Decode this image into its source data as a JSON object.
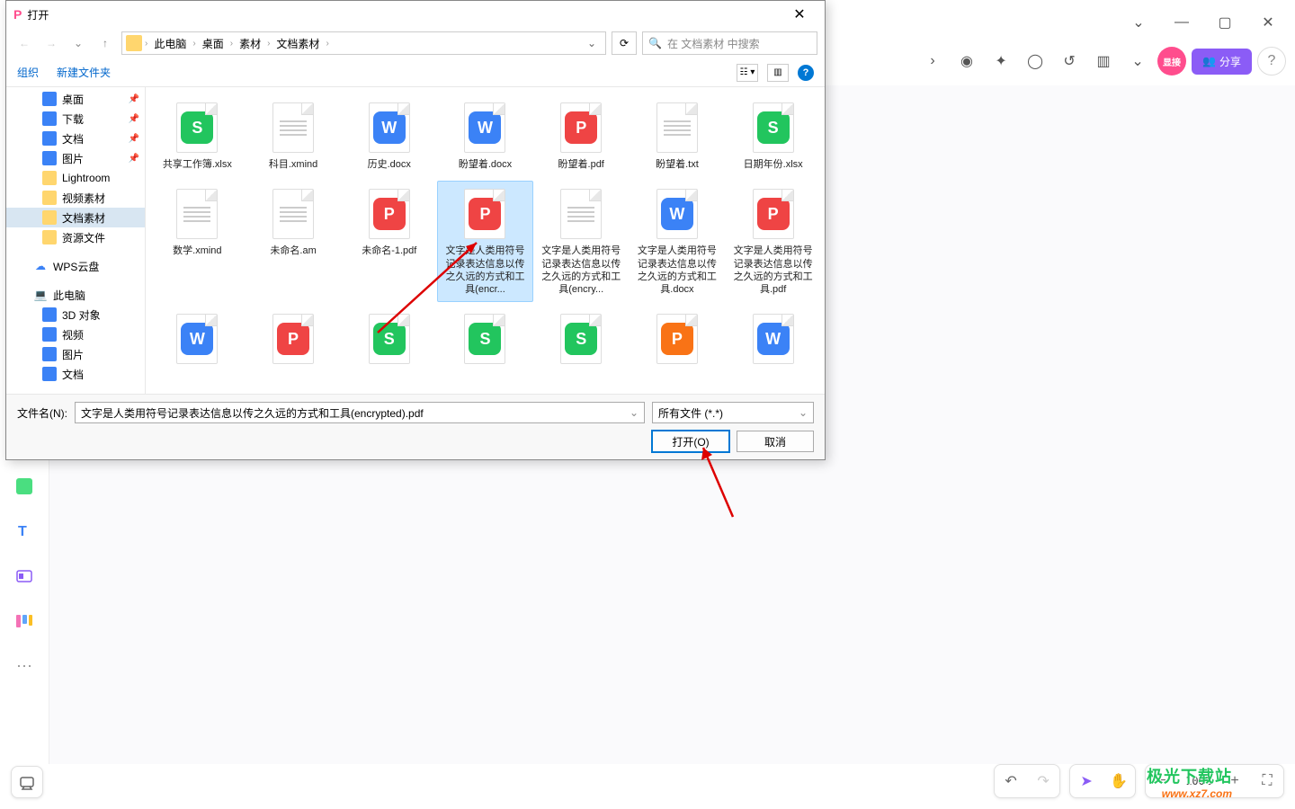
{
  "dialog": {
    "title": "打开",
    "breadcrumb": [
      "此电脑",
      "桌面",
      "素材",
      "文档素材"
    ],
    "search_placeholder": "在 文档素材 中搜索",
    "organize": "组织",
    "new_folder": "新建文件夹",
    "filename_label": "文件名(N):",
    "filename_value": "文字是人类用符号记录表达信息以传之久远的方式和工具(encrypted).pdf",
    "filter": "所有文件 (*.*)",
    "open_btn": "打开(O)",
    "cancel_btn": "取消"
  },
  "tree": [
    {
      "label": "桌面",
      "type": "blue",
      "pin": true,
      "lvl": 1
    },
    {
      "label": "下载",
      "type": "blue",
      "pin": true,
      "lvl": 1
    },
    {
      "label": "文档",
      "type": "blue",
      "pin": true,
      "lvl": 1
    },
    {
      "label": "图片",
      "type": "blue",
      "pin": true,
      "lvl": 1
    },
    {
      "label": "Lightroom",
      "type": "folder",
      "lvl": 1
    },
    {
      "label": "视频素材",
      "type": "folder",
      "lvl": 1
    },
    {
      "label": "文档素材",
      "type": "folder",
      "lvl": 1,
      "sel": true
    },
    {
      "label": "资源文件",
      "type": "folder",
      "lvl": 1
    },
    {
      "label": "WPS云盘",
      "type": "cloud",
      "lvl": 0,
      "gap": true
    },
    {
      "label": "此电脑",
      "type": "pc",
      "lvl": 0,
      "gap": true
    },
    {
      "label": "3D 对象",
      "type": "blue",
      "lvl": 1
    },
    {
      "label": "视频",
      "type": "blue",
      "lvl": 1
    },
    {
      "label": "图片",
      "type": "blue",
      "lvl": 1
    },
    {
      "label": "文档",
      "type": "blue",
      "lvl": 1
    }
  ],
  "files": [
    {
      "name": "共享工作簿.xlsx",
      "badge": "S",
      "cls": "badge-s"
    },
    {
      "name": "科目.xmind",
      "badge": "",
      "cls": "txt"
    },
    {
      "name": "历史.docx",
      "badge": "W",
      "cls": "badge-w"
    },
    {
      "name": "盼望着.docx",
      "badge": "W",
      "cls": "badge-w"
    },
    {
      "name": "盼望着.pdf",
      "badge": "P",
      "cls": "badge-p"
    },
    {
      "name": "盼望着.txt",
      "badge": "",
      "cls": "txt"
    },
    {
      "name": "日期年份.xlsx",
      "badge": "S",
      "cls": "badge-s"
    },
    {
      "name": "数学.xmind",
      "badge": "",
      "cls": "txt"
    },
    {
      "name": "未命名.am",
      "badge": "",
      "cls": "txt"
    },
    {
      "name": "未命名-1.pdf",
      "badge": "P",
      "cls": "badge-p"
    },
    {
      "name": "文字是人类用符号记录表达信息以传之久远的方式和工具(encr...",
      "badge": "P",
      "cls": "badge-p",
      "sel": true
    },
    {
      "name": "文字是人类用符号记录表达信息以传之久远的方式和工具(encry...",
      "badge": "",
      "cls": "txt"
    },
    {
      "name": "文字是人类用符号记录表达信息以传之久远的方式和工具.docx",
      "badge": "W",
      "cls": "badge-w"
    },
    {
      "name": "文字是人类用符号记录表达信息以传之久远的方式和工具.pdf",
      "badge": "P",
      "cls": "badge-p"
    },
    {
      "name": "",
      "badge": "W",
      "cls": "badge-w"
    },
    {
      "name": "",
      "badge": "P",
      "cls": "badge-p"
    },
    {
      "name": "",
      "badge": "S",
      "cls": "badge-s"
    },
    {
      "name": "",
      "badge": "S",
      "cls": "badge-s"
    },
    {
      "name": "",
      "badge": "S",
      "cls": "badge-s"
    },
    {
      "name": "",
      "badge": "P",
      "cls": "badge-o"
    },
    {
      "name": "",
      "badge": "W",
      "cls": "badge-w"
    }
  ],
  "bg": {
    "share": "分享",
    "zoom": "100%",
    "pink_badge": "显接"
  },
  "watermark": {
    "cn": "极光下载站",
    "url": "www.xz7.com"
  }
}
